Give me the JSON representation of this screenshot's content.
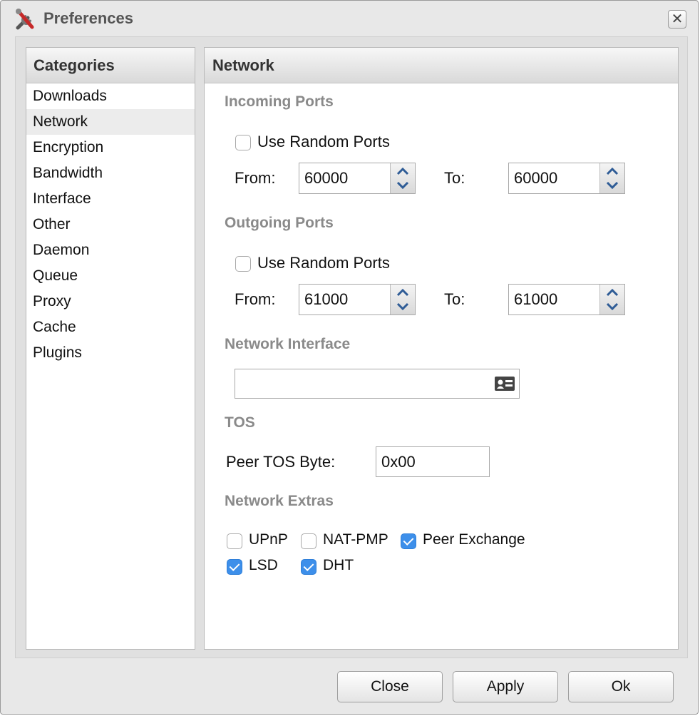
{
  "window": {
    "title": "Preferences",
    "title_icon": "tools-icon",
    "close_glyph": "✕"
  },
  "categories": {
    "header": "Categories",
    "selected": "Network",
    "items": [
      "Downloads",
      "Network",
      "Encryption",
      "Bandwidth",
      "Interface",
      "Other",
      "Daemon",
      "Queue",
      "Proxy",
      "Cache",
      "Plugins"
    ]
  },
  "network": {
    "header": "Network",
    "incoming": {
      "title": "Incoming Ports",
      "random_label": "Use Random Ports",
      "random_checked": false,
      "from_label": "From:",
      "from_value": "60000",
      "to_label": "To:",
      "to_value": "60000"
    },
    "outgoing": {
      "title": "Outgoing Ports",
      "random_label": "Use Random Ports",
      "random_checked": false,
      "from_label": "From:",
      "from_value": "61000",
      "to_label": "To:",
      "to_value": "61000"
    },
    "interface": {
      "title": "Network Interface",
      "value": "",
      "icon": "contact-card-icon"
    },
    "tos": {
      "title": "TOS",
      "peer_tos_label": "Peer TOS Byte:",
      "peer_tos_value": "0x00"
    },
    "extras": {
      "title": "Network Extras",
      "upnp": {
        "label": "UPnP",
        "checked": false
      },
      "natpmp": {
        "label": "NAT-PMP",
        "checked": false
      },
      "peer_exchange": {
        "label": "Peer Exchange",
        "checked": true
      },
      "lsd": {
        "label": "LSD",
        "checked": true
      },
      "dht": {
        "label": "DHT",
        "checked": true
      }
    }
  },
  "footer": {
    "close_label": "Close",
    "apply_label": "Apply",
    "ok_label": "Ok"
  },
  "colors": {
    "checkbox_checked": "#3d8fea",
    "section_title": "#8a8a8a",
    "spinner_arrow": "#2f5c96"
  }
}
